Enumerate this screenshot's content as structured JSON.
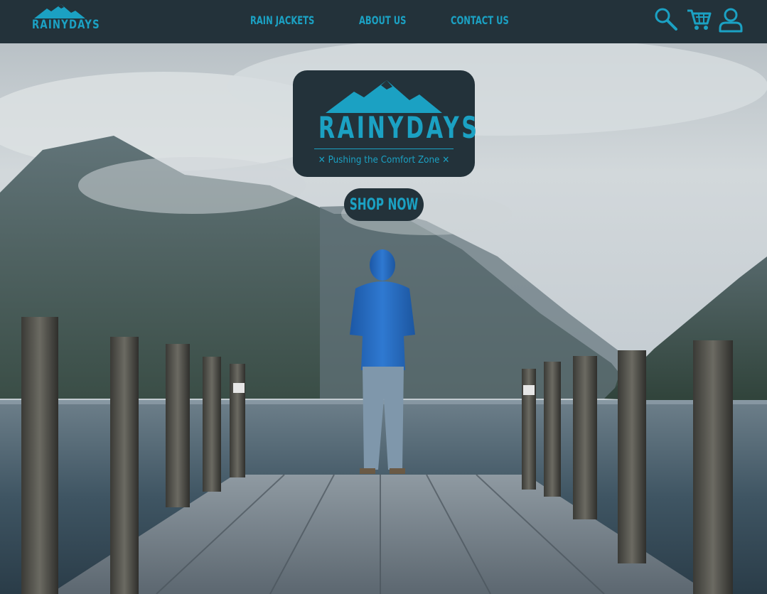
{
  "header": {
    "logo_text": "RAINYDAYS",
    "nav": [
      {
        "label": "Rain Jackets"
      },
      {
        "label": "About us"
      },
      {
        "label": "Contact us"
      }
    ],
    "icons": [
      "search-icon",
      "cart-icon",
      "user-icon"
    ]
  },
  "hero": {
    "brand": "RAINYDAYS",
    "tagline": "✕ Pushing the Comfort Zone ✕",
    "cta_label": "Shop now",
    "image_description_icon": "pier-lake-mountains-photo"
  },
  "colors": {
    "accent": "#1ba1c3",
    "dark": "#23323a"
  }
}
